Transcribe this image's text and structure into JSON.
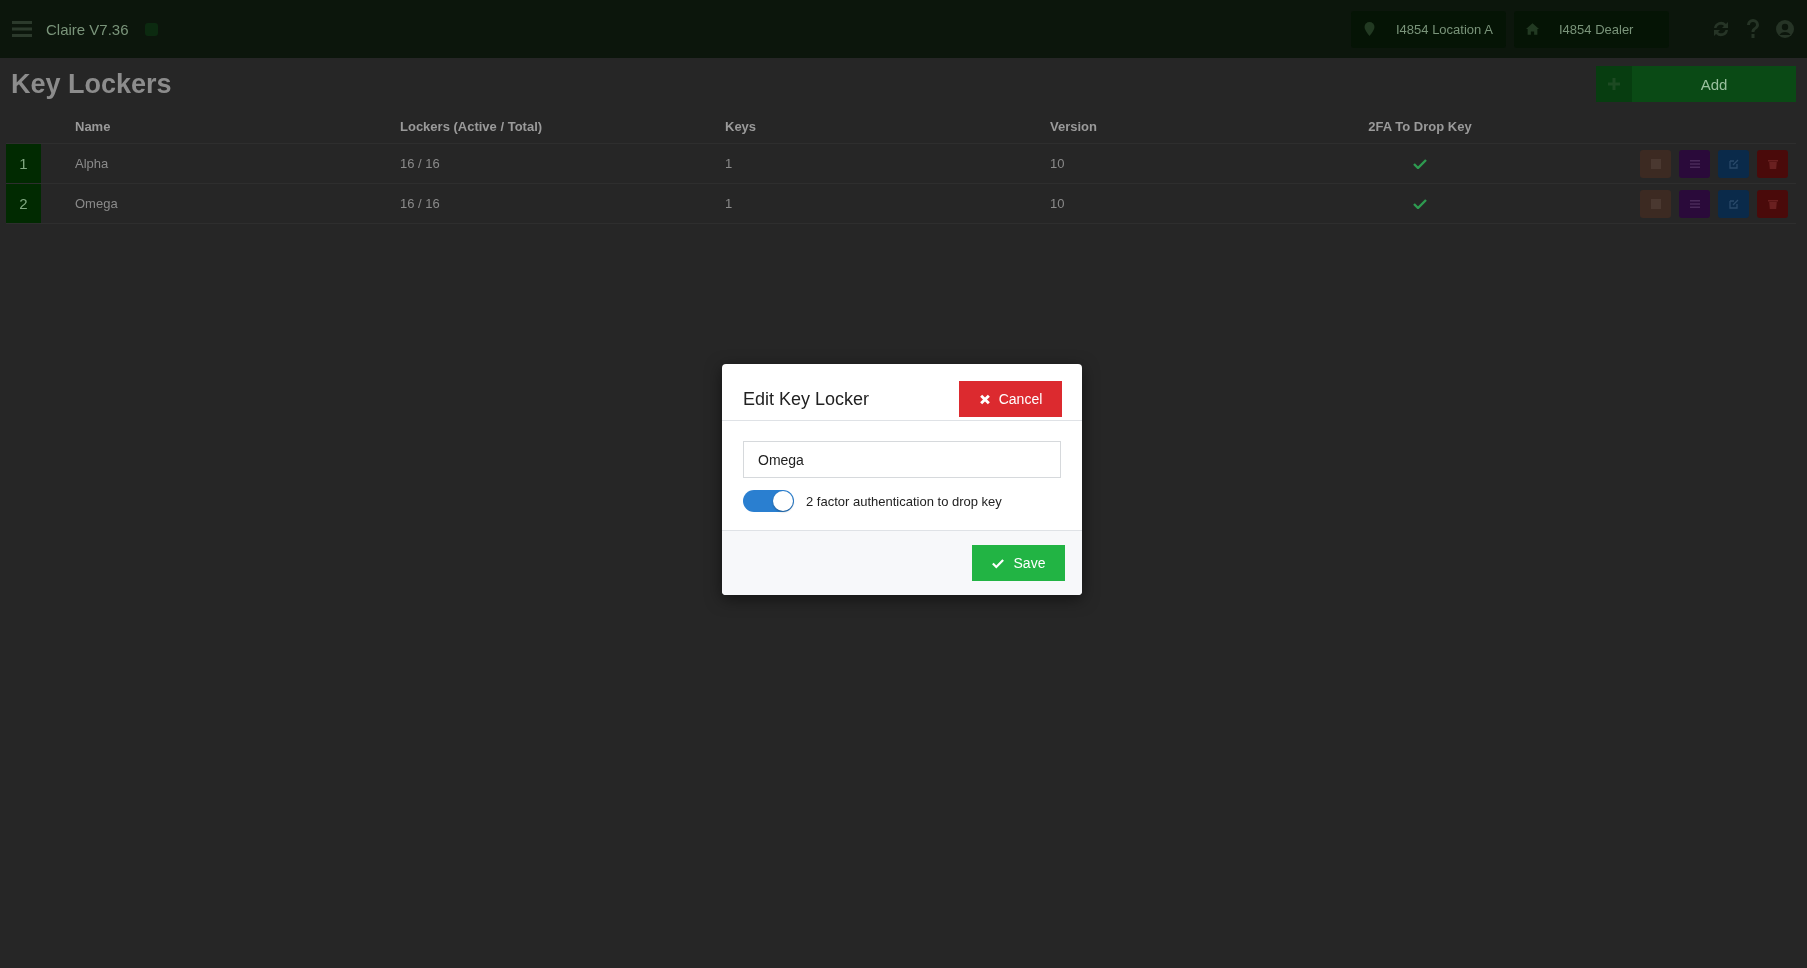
{
  "topbar": {
    "app_title": "Claire V7.36",
    "location": "I4854 Location A",
    "dealer": "I4854 Dealer"
  },
  "page": {
    "title": "Key Lockers",
    "add_button": "Add"
  },
  "table": {
    "columns": [
      "Name",
      "Lockers (Active / Total)",
      "Keys",
      "Version",
      "2FA To Drop Key"
    ],
    "rows": [
      {
        "number": "1",
        "name": "Alpha",
        "lockers": "16 / 16",
        "keys": "1",
        "version": "10",
        "two_fa": true
      },
      {
        "number": "2",
        "name": "Omega",
        "lockers": "16 / 16",
        "keys": "1",
        "version": "10",
        "two_fa": true
      }
    ]
  },
  "modal": {
    "title": "Edit Key Locker",
    "cancel": "Cancel",
    "name_value": "Omega",
    "toggle": {
      "label": "2 factor authentication to drop key",
      "on": true
    },
    "save": "Save"
  }
}
